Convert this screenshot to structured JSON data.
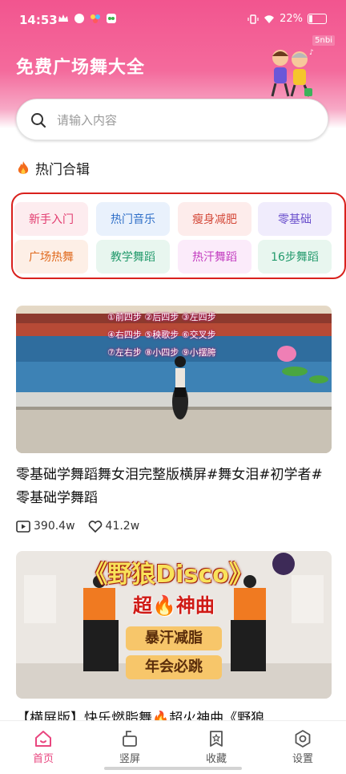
{
  "status_bar": {
    "time": "14:53",
    "battery": "22%"
  },
  "corner_tag": "5nbi",
  "app": {
    "title": "免费广场舞大全"
  },
  "search": {
    "placeholder": "请输入内容"
  },
  "section": {
    "title": "热门合辑"
  },
  "categories": [
    {
      "label": "新手入门",
      "color": "#e23b6f",
      "bg": "#fdecef"
    },
    {
      "label": "热门音乐",
      "color": "#2f6fc8",
      "bg": "#e9f1fc"
    },
    {
      "label": "瘦身减肥",
      "color": "#d44a3a",
      "bg": "#fdeceb"
    },
    {
      "label": "零基础",
      "color": "#6a4fcc",
      "bg": "#f0ecfc"
    },
    {
      "label": "广场热舞",
      "color": "#e06a1e",
      "bg": "#fdefe6"
    },
    {
      "label": "教学舞蹈",
      "color": "#239a6c",
      "bg": "#e8f6ef"
    },
    {
      "label": "热汗舞蹈",
      "color": "#c23bbf",
      "bg": "#fbebfa"
    },
    {
      "label": "16步舞蹈",
      "color": "#239a6c",
      "bg": "#e8f6ef"
    }
  ],
  "videos": [
    {
      "title": "零基础学舞蹈舞女泪完整版横屏#舞女泪#初学者#零基础学舞蹈",
      "plays": "390.4w",
      "likes": "41.2w",
      "overlay_steps": [
        "①前四步 ②后四步 ③左四步",
        "④右四步 ⑤秧歌步 ⑥交叉步",
        "⑦左右步 ⑧小四步 ⑨小摆胯"
      ]
    },
    {
      "title": "【横屏版】快乐燃脂舞🔥超火神曲《野狼",
      "banner": "《野狼Disco》",
      "subtitle": "超🔥神曲",
      "badges": [
        "暴汗减脂",
        "年会必跳"
      ]
    }
  ],
  "nav": [
    {
      "label": "首页",
      "active": true,
      "icon": "home-icon"
    },
    {
      "label": "竖屏",
      "active": false,
      "icon": "vertical-screen-icon"
    },
    {
      "label": "收藏",
      "active": false,
      "icon": "favorite-icon"
    },
    {
      "label": "设置",
      "active": false,
      "icon": "settings-icon"
    }
  ],
  "colors": {
    "brand": "#f2558f",
    "highlight_border": "#d9211d",
    "active_nav": "#e9467f"
  }
}
